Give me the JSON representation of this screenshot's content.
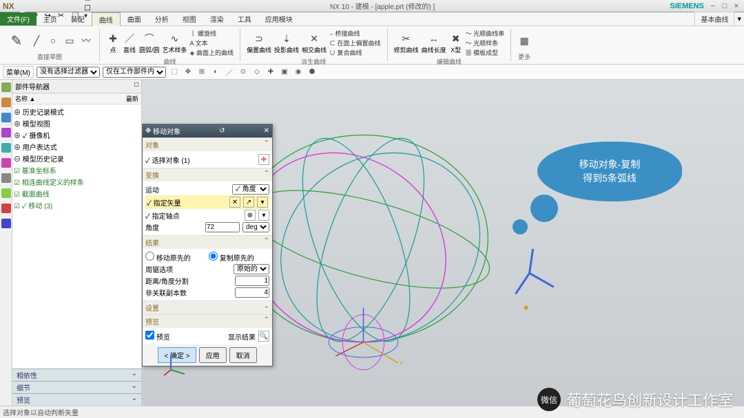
{
  "app": {
    "name": "NX",
    "title": "NX 10 - 建模 - [apple.prt  (修改的) ]",
    "brand": "SIEMENS"
  },
  "menu": {
    "file": "文件(F)",
    "tabs": [
      "主页",
      "装配",
      "曲线",
      "曲面",
      "分析",
      "视图",
      "渲染",
      "工具",
      "应用模块"
    ],
    "active": "曲线",
    "right": "基本曲线"
  },
  "ribbon": {
    "g1": {
      "label": "直接草图"
    },
    "g2": {
      "label": "曲线",
      "items": [
        "点",
        "直线",
        "圆弧/圆",
        "艺术样条"
      ]
    },
    "g3": {
      "items": [
        "螺旋线",
        "文本",
        "曲面上的曲线"
      ]
    },
    "g4": {
      "label": "派生曲线",
      "items": [
        "偏置曲线",
        "投影曲线",
        "相交曲线"
      ]
    },
    "g5": {
      "items": [
        "桥接曲线",
        "在面上偏置曲线",
        "复合曲线"
      ]
    },
    "g6": {
      "label": "编辑曲线",
      "items": [
        "修剪曲线",
        "曲线长度",
        "X型"
      ]
    },
    "g7": {
      "items": [
        "光顺曲线串",
        "光顺样条",
        "模板成型"
      ]
    },
    "g8": {
      "label": "更多"
    }
  },
  "selbar": {
    "menu": "菜单(M)",
    "filter1": "没有选择过滤器",
    "filter2": "仅在工作部件内"
  },
  "nav": {
    "title": "部件导航器",
    "cols": [
      "名称 ▲",
      "最新"
    ],
    "tree": [
      "⊕ 历史记录模式",
      "⊕ 模型视图",
      "⊕ ✓ 摄像机",
      "⊕ 用户表达式",
      "⊖ 模型历史记录",
      "  ☑ 基准坐标系",
      "  ☑ 相连曲线定义的样条",
      "  ☑ 截面曲线",
      "  ☑ ✓ 移动 (3)"
    ],
    "bottom": [
      "相依性",
      "细节",
      "预览"
    ]
  },
  "dialog": {
    "title": "移动对象",
    "sec_object": "对象",
    "select_obj": "✓ 选择对象 (1)",
    "sec_transform": "变换",
    "motion": "运动",
    "motion_val": "角度",
    "vector": "✓ 指定矢量",
    "pivot": "✓ 指定轴点",
    "angle": "角度",
    "angle_val": "72",
    "angle_unit": "deg",
    "sec_result": "结果",
    "opt_move": "移动原先的",
    "opt_copy": "复制原先的",
    "loop": "周锯选项",
    "loop_val": "原始的",
    "dist_div": "距离/角度分割",
    "dist_div_val": "1",
    "copies": "非关联副本数",
    "copies_val": "4",
    "sec_settings": "设置",
    "sec_preview": "预览",
    "preview_chk": "预览",
    "show_result": "显示结果",
    "ok": "< 确定 >",
    "apply": "应用",
    "cancel": "取消"
  },
  "callout": {
    "line1": "移动对象-复制",
    "line2": "得到5条弧线"
  },
  "status": "选择对象以自动判断失量",
  "watermark": "葡萄花鸟创新设计工作室"
}
